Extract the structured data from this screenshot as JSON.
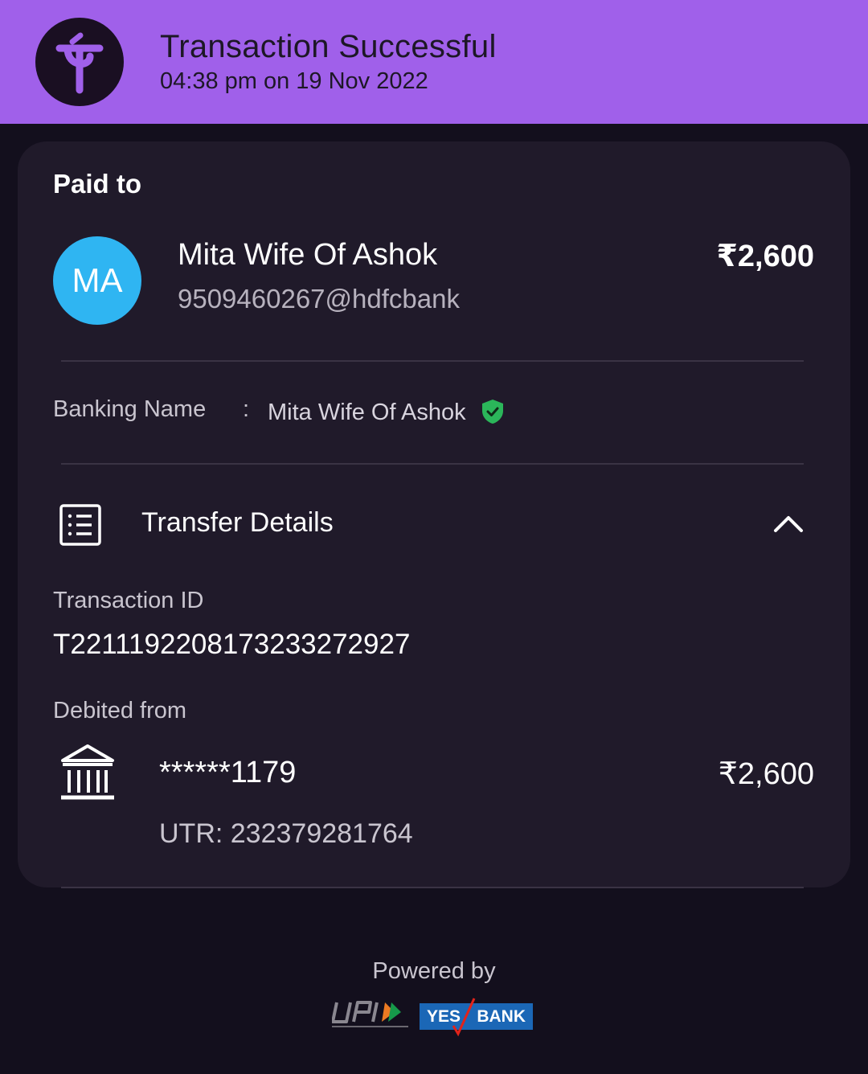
{
  "header": {
    "logo_icon": "phonepe-logo-icon",
    "title": "Transaction Successful",
    "timestamp": "04:38 pm on 19 Nov 2022",
    "bg_color": "#a060ea"
  },
  "payee": {
    "section_label": "Paid to",
    "avatar_initials": "MA",
    "avatar_color": "#2fb5f2",
    "name": "Mita Wife Of Ashok",
    "upi_id": "9509460267@hdfcbank",
    "amount": "₹2,600"
  },
  "banking_name": {
    "label": "Banking Name",
    "separator": ":",
    "value": "Mita Wife Of Ashok",
    "verified_icon": "verified-shield-icon"
  },
  "transfer_details": {
    "title": "Transfer Details",
    "icon": "receipt-list-icon",
    "toggle_icon": "chevron-up-icon",
    "transaction_id_label": "Transaction ID",
    "transaction_id": "T2211192208173233272927",
    "debited_from_label": "Debited from",
    "bank_icon": "bank-icon",
    "account": "******1179",
    "amount": "₹2,600",
    "utr": "UTR: 232379281764"
  },
  "footer": {
    "powered_by": "Powered by",
    "upi_logo": "upi-logo",
    "partner_bank_yes": "YES",
    "partner_bank_bank": "BANK"
  }
}
